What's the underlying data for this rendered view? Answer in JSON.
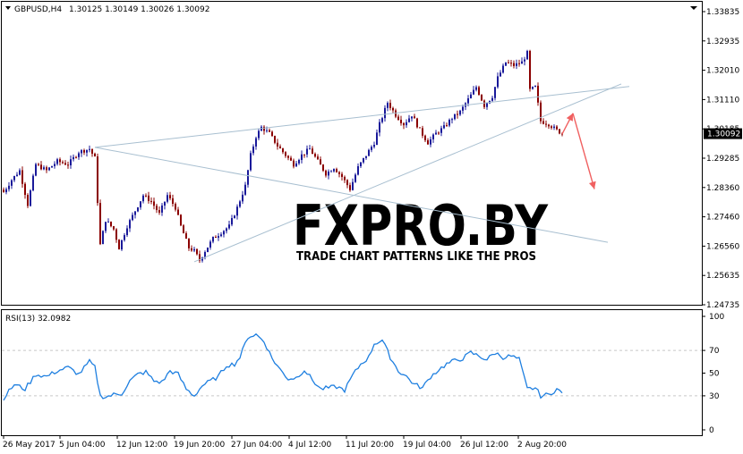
{
  "chart_data": [
    {
      "type": "candlestick",
      "symbol_header": "GBPUSD,H4",
      "ohlc_header": "1.30125 1.30149 1.30026 1.30092",
      "current_price": "1.30092",
      "y_ticks": [
        "1.33835",
        "1.32935",
        "1.32010",
        "1.31110",
        "1.30185",
        "1.29285",
        "1.28360",
        "1.27460",
        "1.26560",
        "1.25635",
        "1.24735"
      ],
      "x_ticks": [
        "26 May 2017",
        "5 Jun 04:00",
        "12 Jun 12:00",
        "19 Jun 20:00",
        "27 Jun 04:00",
        "4 Jul 12:00",
        "11 Jul 20:00",
        "19 Jul 04:00",
        "26 Jul 12:00",
        "2 Aug 20:00"
      ],
      "ylim": [
        1.2456,
        1.3401
      ],
      "close_anchors": [
        [
          0,
          1.282
        ],
        [
          3,
          1.286
        ],
        [
          6,
          1.289
        ],
        [
          9,
          1.278
        ],
        [
          12,
          1.291
        ],
        [
          16,
          1.289
        ],
        [
          20,
          1.292
        ],
        [
          24,
          1.291
        ],
        [
          28,
          1.295
        ],
        [
          32,
          1.296
        ],
        [
          34,
          1.293
        ],
        [
          36,
          1.265
        ],
        [
          38,
          1.273
        ],
        [
          41,
          1.27
        ],
        [
          43,
          1.264
        ],
        [
          46,
          1.271
        ],
        [
          49,
          1.276
        ],
        [
          52,
          1.281
        ],
        [
          55,
          1.279
        ],
        [
          58,
          1.275
        ],
        [
          61,
          1.281
        ],
        [
          64,
          1.277
        ],
        [
          66,
          1.271
        ],
        [
          69,
          1.264
        ],
        [
          71,
          1.263
        ],
        [
          73,
          1.26
        ],
        [
          75,
          1.263
        ],
        [
          78,
          1.267
        ],
        [
          81,
          1.269
        ],
        [
          84,
          1.271
        ],
        [
          87,
          1.277
        ],
        [
          90,
          1.284
        ],
        [
          92,
          1.294
        ],
        [
          94,
          1.3
        ],
        [
          96,
          1.303
        ],
        [
          99,
          1.301
        ],
        [
          102,
          1.297
        ],
        [
          105,
          1.294
        ],
        [
          108,
          1.291
        ],
        [
          111,
          1.294
        ],
        [
          114,
          1.296
        ],
        [
          117,
          1.292
        ],
        [
          120,
          1.288
        ],
        [
          123,
          1.29
        ],
        [
          126,
          1.287
        ],
        [
          129,
          1.283
        ],
        [
          132,
          1.29
        ],
        [
          135,
          1.294
        ],
        [
          138,
          1.298
        ],
        [
          140,
          1.304
        ],
        [
          143,
          1.311
        ],
        [
          146,
          1.307
        ],
        [
          149,
          1.304
        ],
        [
          152,
          1.307
        ],
        [
          155,
          1.302
        ],
        [
          158,
          1.298
        ],
        [
          161,
          1.301
        ],
        [
          164,
          1.303
        ],
        [
          167,
          1.306
        ],
        [
          170,
          1.308
        ],
        [
          173,
          1.312
        ],
        [
          176,
          1.316
        ],
        [
          179,
          1.31
        ],
        [
          182,
          1.313
        ],
        [
          184,
          1.319
        ],
        [
          187,
          1.324
        ],
        [
          190,
          1.323
        ],
        [
          193,
          1.324
        ],
        [
          195,
          1.327
        ],
        [
          196,
          1.315
        ],
        [
          198,
          1.316
        ],
        [
          200,
          1.305
        ],
        [
          203,
          1.304
        ],
        [
          206,
          1.302
        ],
        [
          208,
          1.301
        ]
      ],
      "trendlines": [
        {
          "start": [
            34,
            1.2965
          ],
          "end": [
            233,
            1.3162
          ]
        },
        {
          "start": [
            34,
            1.2965
          ],
          "end": [
            225,
            1.2658
          ]
        },
        {
          "start": [
            71,
            1.2595
          ],
          "end": [
            230,
            1.317
          ]
        }
      ],
      "forecast_arrows": [
        {
          "start": [
            208,
            1.3008
          ],
          "end": [
            212,
            1.3075
          ]
        },
        {
          "start": [
            212,
            1.3075
          ],
          "end": [
            220,
            1.283
          ]
        }
      ]
    },
    {
      "type": "line",
      "indicator_label": "RSI(13) 32.0982",
      "y_ticks": [
        "100",
        "70",
        "50",
        "30",
        "0"
      ],
      "ylim": [
        0,
        100
      ],
      "rsi_anchors": [
        [
          0,
          28
        ],
        [
          4,
          40
        ],
        [
          8,
          36
        ],
        [
          12,
          49
        ],
        [
          16,
          47
        ],
        [
          20,
          52
        ],
        [
          24,
          55
        ],
        [
          28,
          49
        ],
        [
          32,
          60
        ],
        [
          34,
          55
        ],
        [
          36,
          30
        ],
        [
          38,
          29
        ],
        [
          41,
          31
        ],
        [
          44,
          32
        ],
        [
          47,
          43
        ],
        [
          50,
          49
        ],
        [
          53,
          51
        ],
        [
          56,
          43
        ],
        [
          59,
          42
        ],
        [
          62,
          52
        ],
        [
          65,
          49
        ],
        [
          68,
          36
        ],
        [
          71,
          30
        ],
        [
          74,
          39
        ],
        [
          77,
          43
        ],
        [
          80,
          47
        ],
        [
          83,
          57
        ],
        [
          86,
          58
        ],
        [
          88,
          64
        ],
        [
          91,
          82
        ],
        [
          94,
          84
        ],
        [
          97,
          78
        ],
        [
          100,
          63
        ],
        [
          103,
          53
        ],
        [
          106,
          45
        ],
        [
          109,
          46
        ],
        [
          112,
          53
        ],
        [
          115,
          44
        ],
        [
          118,
          36
        ],
        [
          121,
          37
        ],
        [
          124,
          38
        ],
        [
          127,
          35
        ],
        [
          130,
          48
        ],
        [
          133,
          58
        ],
        [
          136,
          64
        ],
        [
          138,
          76
        ],
        [
          141,
          79
        ],
        [
          144,
          64
        ],
        [
          147,
          52
        ],
        [
          150,
          47
        ],
        [
          153,
          40
        ],
        [
          156,
          37
        ],
        [
          159,
          47
        ],
        [
          162,
          53
        ],
        [
          165,
          58
        ],
        [
          168,
          61
        ],
        [
          171,
          63
        ],
        [
          174,
          68
        ],
        [
          177,
          65
        ],
        [
          180,
          62
        ],
        [
          183,
          68
        ],
        [
          186,
          64
        ],
        [
          189,
          65
        ],
        [
          192,
          62
        ],
        [
          195,
          36
        ],
        [
          198,
          37
        ],
        [
          200,
          30
        ],
        [
          203,
          31
        ],
        [
          206,
          36
        ],
        [
          208,
          32
        ]
      ]
    }
  ],
  "watermark": {
    "title": "FXPRO.BY",
    "subtitle": "TRADE CHART PATTERNS LIKE THE PROS"
  },
  "colors": {
    "bull": "#1a1a9a",
    "bear": "#8b0000",
    "rsi": "#1e7fe0",
    "trendline": "#a8bfd0",
    "arrow": "#f06060",
    "price_tag": "#000000"
  }
}
